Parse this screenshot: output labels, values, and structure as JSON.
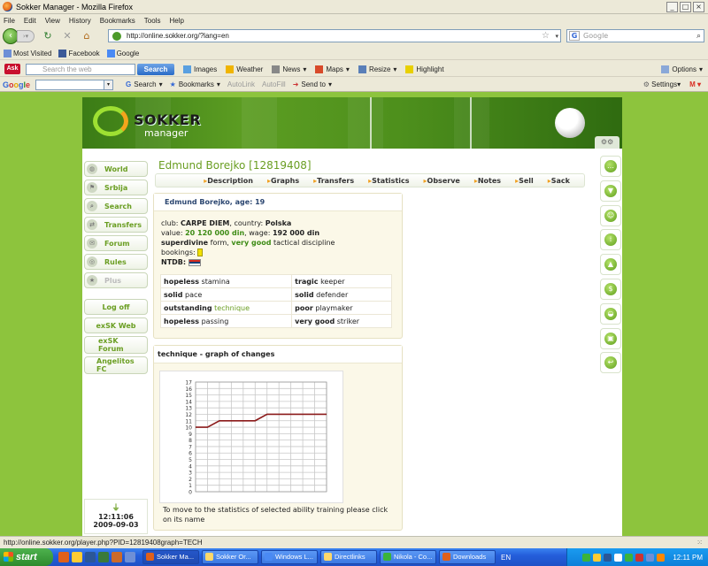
{
  "window": {
    "title": "Sokker Manager - Mozilla Firefox"
  },
  "menu": [
    "File",
    "Edit",
    "View",
    "History",
    "Bookmarks",
    "Tools",
    "Help"
  ],
  "nav": {
    "url": "http://online.sokker.org/?lang=en",
    "search_placeholder": "Google"
  },
  "bookmarks": [
    "Most Visited",
    "Facebook",
    "Google"
  ],
  "ask_toolbar": {
    "search_placeholder": "Search the web",
    "search_button": "Search",
    "items": [
      "Images",
      "Weather",
      "News",
      "Maps",
      "Resize",
      "Highlight"
    ],
    "options": "Options"
  },
  "google_toolbar": {
    "logo": "Google",
    "items": [
      "Search",
      "Bookmarks",
      "AutoLink",
      "AutoFill",
      "Send to"
    ],
    "settings": "Settings"
  },
  "site": {
    "logo_top": "SOKKER",
    "logo_bottom": "manager"
  },
  "left_nav": [
    "World",
    "Srbija",
    "Search",
    "Transfers",
    "Forum",
    "Rules",
    "Plus"
  ],
  "left_links": [
    "Log off",
    "exSK Web",
    "exSK Forum",
    "Angelitos FC"
  ],
  "clock": {
    "time": "12:11:06",
    "date": "2009-09-03"
  },
  "player": {
    "title": "Edmund Borejko [12819408]",
    "tabs": [
      "Description",
      "Graphs",
      "Transfers",
      "Statistics",
      "Observe",
      "Notes",
      "Sell",
      "Sack"
    ],
    "header": "Edmund Borejko, age: 19",
    "club_label": "club:",
    "club": "CARPE DIEM",
    "country_label": ", country:",
    "country": "Polska",
    "value_label": "value:",
    "value": "20 120 000 din",
    "wage_label": ", wage:",
    "wage": "192 000 din",
    "form_word": "superdivine",
    "form_text": "form,",
    "tactic_word": "very good",
    "tactic_text": "tactical discipline",
    "bookings_label": "bookings:",
    "ntdb_label": "NTDB:",
    "skills": [
      {
        "level": "hopeless",
        "skill": "stamina"
      },
      {
        "level": "tragic",
        "skill": "keeper"
      },
      {
        "level": "solid",
        "skill": "pace"
      },
      {
        "level": "solid",
        "skill": "defender"
      },
      {
        "level": "outstanding",
        "skill": "technique"
      },
      {
        "level": "poor",
        "skill": "playmaker"
      },
      {
        "level": "hopeless",
        "skill": "passing"
      },
      {
        "level": "very good",
        "skill": "striker"
      }
    ]
  },
  "graph": {
    "header": "technique - graph of changes",
    "hint": "To move to the statistics of selected ability training please click on its name"
  },
  "chart_data": {
    "type": "line",
    "ylim": [
      0,
      17
    ],
    "yticks": [
      0,
      1,
      2,
      3,
      4,
      5,
      6,
      7,
      8,
      9,
      10,
      11,
      12,
      13,
      14,
      15,
      16,
      17
    ],
    "x": [
      0,
      1,
      2,
      3,
      4,
      5,
      6,
      7,
      8,
      9,
      10,
      11
    ],
    "series": [
      {
        "values": [
          10,
          10,
          11,
          11,
          11,
          11,
          12,
          12,
          12,
          12,
          12,
          12
        ],
        "color": "#8b1a1a"
      }
    ]
  },
  "status": {
    "text": "http://online.sokker.org/player.php?PID=12819408graph=TECH"
  },
  "taskbar": {
    "start": "start",
    "tasks": [
      "Sokker Ma...",
      "Sokker Or...",
      "Windows L...",
      "Directlinks",
      "Nikola - Co...",
      "Downloads"
    ],
    "lang": "EN",
    "time": "12:11 PM"
  },
  "colors": {
    "page_bg": "#8dc43d",
    "accent": "#6a9e22",
    "graph_line": "#8b1a1a"
  }
}
